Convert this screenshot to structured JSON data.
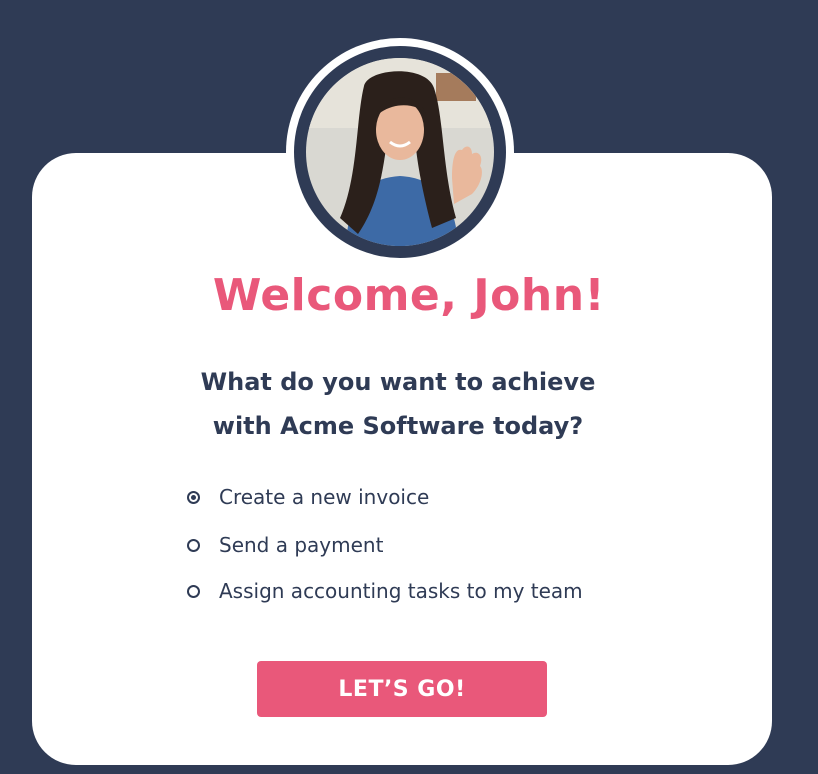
{
  "dialog": {
    "avatar_icon": "user-photo",
    "title": "Welcome, John!",
    "question_line1": "What do you want to achieve",
    "question_line2": "with Acme Software today?",
    "options": [
      {
        "label": "Create a new invoice",
        "selected": true
      },
      {
        "label": "Send a payment",
        "selected": false
      },
      {
        "label": "Assign accounting tasks to my team",
        "selected": false
      }
    ],
    "cta_label": "LET’S GO!"
  },
  "colors": {
    "background": "#2f3b55",
    "card": "#ffffff",
    "accent": "#e9587a",
    "text": "#2f3b55"
  }
}
